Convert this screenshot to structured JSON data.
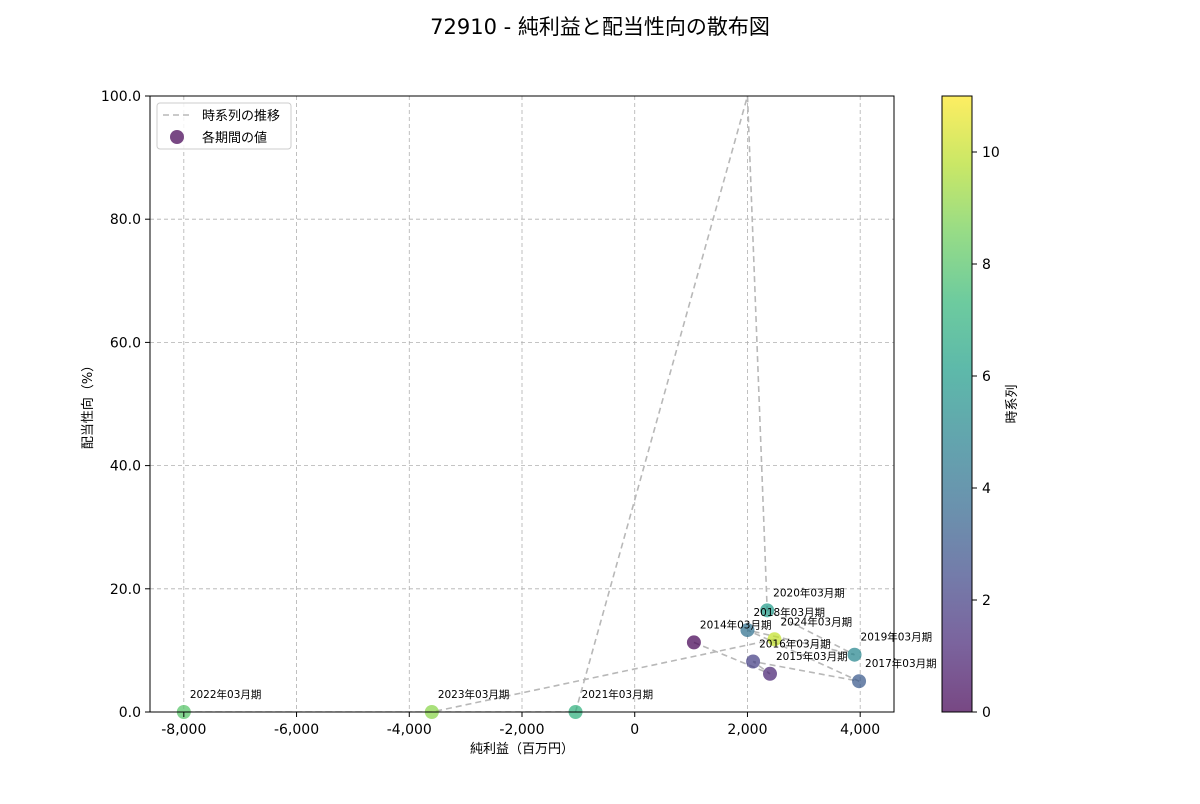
{
  "chart_data": {
    "type": "scatter",
    "title": "72910 - 純利益と配当性向の散布図",
    "xlabel": "純利益（百万円）",
    "ylabel": "配当性向（%）",
    "xlim": [
      -8600,
      4600
    ],
    "ylim": [
      0,
      100
    ],
    "x_ticks": [
      -8000,
      -6000,
      -4000,
      -2000,
      0,
      2000,
      4000
    ],
    "x_tick_labels": [
      "-8,000",
      "-6,000",
      "-4,000",
      "-2,000",
      "0",
      "2,000",
      "4,000"
    ],
    "y_ticks": [
      0,
      20,
      40,
      60,
      80,
      100
    ],
    "y_tick_labels": [
      "0.0",
      "20.0",
      "40.0",
      "60.0",
      "80.0",
      "100.0"
    ],
    "grid": true,
    "legend": {
      "placement": "top-left",
      "entries": [
        "時系列の推移",
        "各期間の値"
      ]
    },
    "colorbar": {
      "label": "時系列",
      "range": [
        0,
        11
      ],
      "ticks": [
        0,
        2,
        4,
        6,
        8,
        10
      ],
      "tick_labels": [
        "0",
        "2",
        "4",
        "6",
        "8",
        "10"
      ],
      "colormap": [
        "#440154",
        "#482878",
        "#3e4989",
        "#31688e",
        "#26828e",
        "#1f9e89",
        "#35b779",
        "#6ece58",
        "#b5de2b",
        "#fde725"
      ]
    },
    "line_path": [
      {
        "x": 1050,
        "y": 11.3
      },
      {
        "x": 2400,
        "y": 6.2
      },
      {
        "x": 2100,
        "y": 8.2
      },
      {
        "x": 3980,
        "y": 5.0
      },
      {
        "x": 2000,
        "y": 13.3
      },
      {
        "x": 3900,
        "y": 9.3
      },
      {
        "x": 2350,
        "y": 16.5
      },
      {
        "x": 2000,
        "y": 100
      },
      {
        "x": -1050,
        "y": 0
      },
      {
        "x": -8000,
        "y": 0
      },
      {
        "x": -3600,
        "y": 0
      },
      {
        "x": 2480,
        "y": 11.8
      }
    ],
    "points": [
      {
        "label": "2014年03月期",
        "x": 1050,
        "y": 11.3,
        "t": 0
      },
      {
        "label": "2015年03月期",
        "x": 2400,
        "y": 6.2,
        "t": 1
      },
      {
        "label": "2016年03月期",
        "x": 2100,
        "y": 8.2,
        "t": 2
      },
      {
        "label": "2017年03月期",
        "x": 3980,
        "y": 5.0,
        "t": 3
      },
      {
        "label": "2018年03月期",
        "x": 2000,
        "y": 13.3,
        "t": 4
      },
      {
        "label": "2019年03月期",
        "x": 3900,
        "y": 9.3,
        "t": 5
      },
      {
        "label": "2020年03月期",
        "x": 2350,
        "y": 16.5,
        "t": 6
      },
      {
        "label": "2021年03月期",
        "x": -1050,
        "y": 0,
        "t": 7
      },
      {
        "label": "2022年03月期",
        "x": -8000,
        "y": 0,
        "t": 8
      },
      {
        "label": "2023年03月期",
        "x": -3600,
        "y": 0,
        "t": 9
      },
      {
        "label": "2024年03月期",
        "x": 2480,
        "y": 11.8,
        "t": 10
      }
    ]
  }
}
